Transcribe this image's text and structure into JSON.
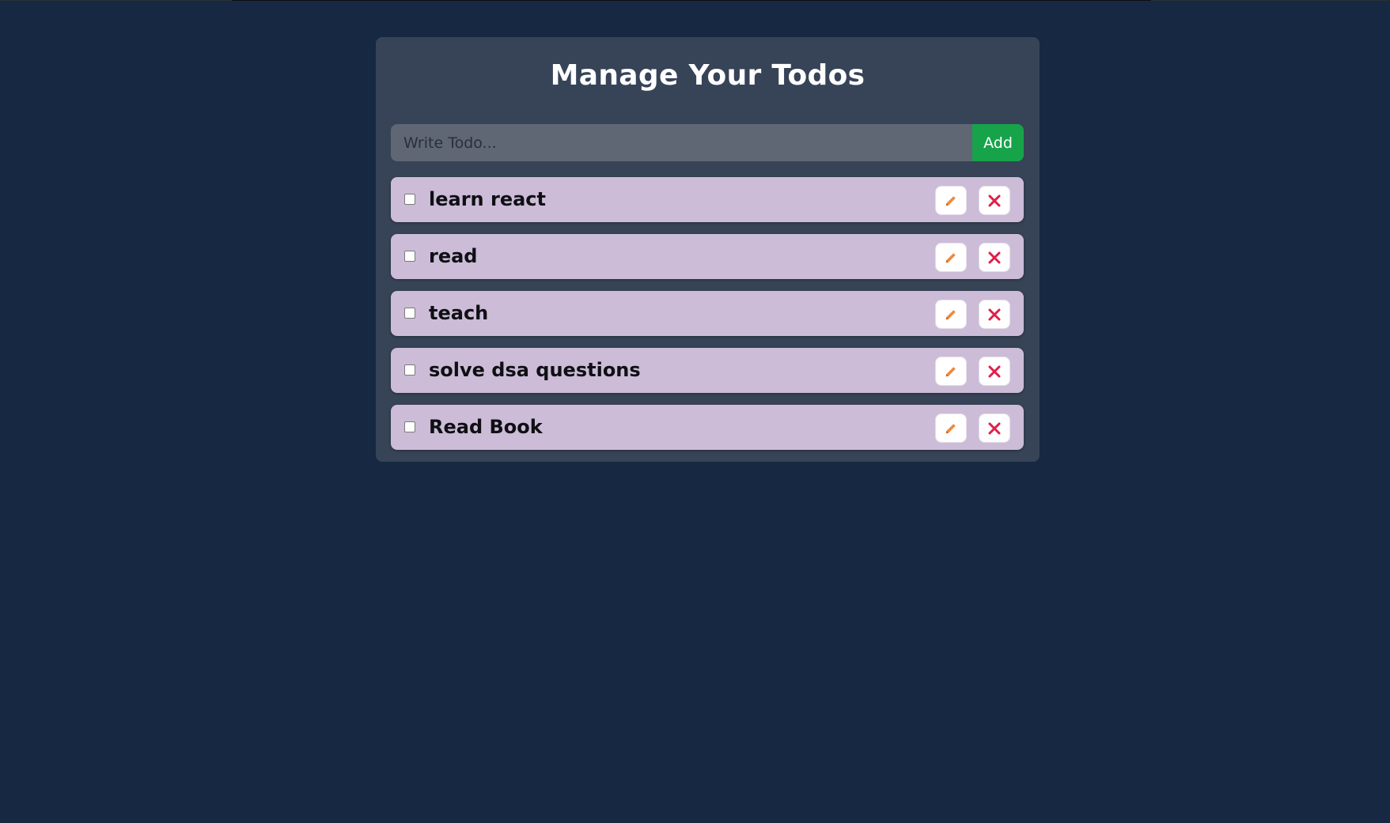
{
  "app": {
    "title": "Manage Your Todos"
  },
  "add_form": {
    "placeholder": "Write Todo...",
    "value": "",
    "add_label": "Add"
  },
  "colors": {
    "background": "#172842",
    "card": "#374357",
    "input": "#5f6774",
    "add_button": "#17a34a",
    "todo_item": "#ccbcd7",
    "edit_icon": "#f0883a",
    "delete_icon": "#e11d48"
  },
  "todos": [
    {
      "text": "learn react",
      "completed": false,
      "edit_icon": "pencil-icon",
      "delete_icon": "close-icon"
    },
    {
      "text": "read",
      "completed": false,
      "edit_icon": "pencil-icon",
      "delete_icon": "close-icon"
    },
    {
      "text": "teach",
      "completed": false,
      "edit_icon": "pencil-icon",
      "delete_icon": "close-icon"
    },
    {
      "text": "solve dsa questions",
      "completed": false,
      "edit_icon": "pencil-icon",
      "delete_icon": "close-icon"
    },
    {
      "text": "Read Book",
      "completed": false,
      "edit_icon": "pencil-icon",
      "delete_icon": "close-icon"
    }
  ]
}
